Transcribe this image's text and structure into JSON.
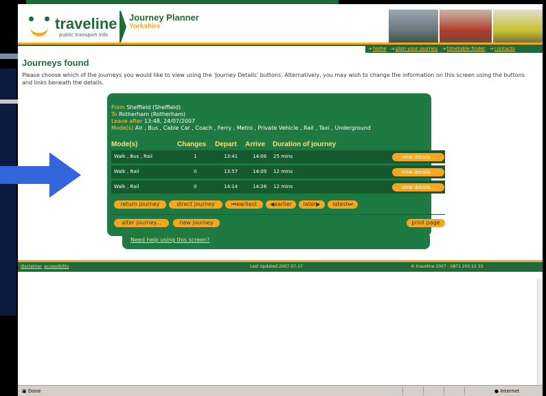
{
  "header": {
    "logo_text": "traveline",
    "logo_tagline": "public transport info",
    "app_title": "Journey Planner",
    "app_subtitle": "Yorkshire"
  },
  "top_links": [
    "home",
    "plan your journey",
    "timetable finder",
    "contacts"
  ],
  "page": {
    "heading": "Journeys found",
    "intro": "Please choose which of the journeys you would like to view using the 'Journey Details' buttons. Alternatively, you may wish to change the information on this screen using the buttons and links beneath the details."
  },
  "journey": {
    "from_label": "From",
    "from_value": "Sheffield (Sheffield)",
    "to_label": "To",
    "to_value": "Rotherham (Rotherham)",
    "leave_label": "Leave after",
    "leave_value": "13:48, 24/07/2007",
    "modes_label": "Mode(s)",
    "modes_value": "Air , Bus , Cable Car , Coach , Ferry , Metro , Private Vehicle , Rail , Taxi , Underground"
  },
  "table": {
    "headers": [
      "Mode(s)",
      "Changes",
      "Depart",
      "Arrive",
      "Duration of journey"
    ],
    "rows": [
      {
        "modes": "Walk , Bus , Rail",
        "changes": "1",
        "depart": "13:41",
        "arrive": "14:06",
        "duration": "25 mins",
        "button": "view details..."
      },
      {
        "modes": "Walk , Rail",
        "changes": "0",
        "depart": "13:57",
        "arrive": "14:09",
        "duration": "12 mins",
        "button": "view details..."
      },
      {
        "modes": "Walk , Rail",
        "changes": "0",
        "depart": "14:14",
        "arrive": "14:26",
        "duration": "12 mins",
        "button": "view details..."
      }
    ]
  },
  "nav_buttons": {
    "return": "return journey",
    "direct": "direct journey",
    "earliest": "earliest",
    "earlier": "earlier",
    "later": "later",
    "latest": "latest"
  },
  "action_buttons": {
    "alter": "alter journey...",
    "new": "new journey",
    "print": "print page"
  },
  "help_link": "Need help using this screen?",
  "footer": {
    "disclaimer": "disclaimer",
    "accessibility": "accessibility",
    "updated": "Last Updated:2007-07-17",
    "copyright": "© traveline 2007 - 0871 200 22 33"
  },
  "statusbar": {
    "status": "Done",
    "zone": "Internet"
  },
  "colors": {
    "green": "#1e6b37",
    "orange": "#f7a71c",
    "arrow": "#3366dd"
  }
}
